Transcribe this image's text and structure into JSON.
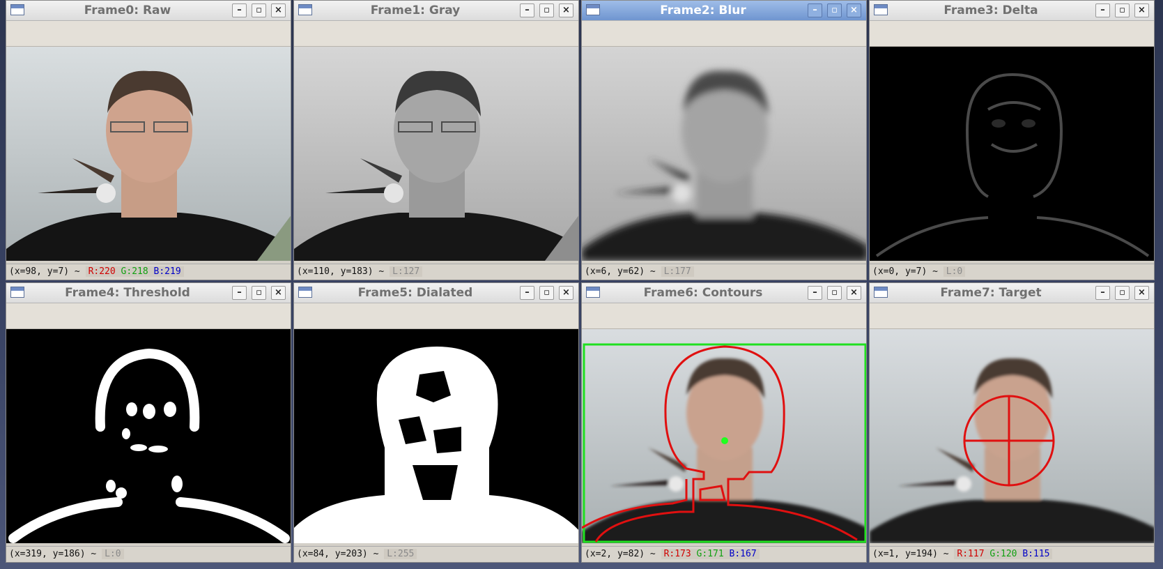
{
  "windows": [
    {
      "title": "Frame0: Raw",
      "status": {
        "coord": "(x=98, y=7) ~",
        "r": "R:220",
        "g": "G:218",
        "b": "B:219"
      }
    },
    {
      "title": "Frame1: Gray",
      "status": {
        "coord": "(x=110, y=183) ~",
        "l": "L:127"
      }
    },
    {
      "title": "Frame2: Blur",
      "status": {
        "coord": "(x=6, y=62) ~",
        "l": "L:177"
      }
    },
    {
      "title": "Frame3: Delta",
      "status": {
        "coord": "(x=0, y=7) ~",
        "l": "L:0"
      }
    },
    {
      "title": "Frame4: Threshold",
      "status": {
        "coord": "(x=319, y=186) ~",
        "l": "L:0"
      }
    },
    {
      "title": "Frame5: Dialated",
      "status": {
        "coord": "(x=84, y=203) ~",
        "l": "L:255"
      }
    },
    {
      "title": "Frame6: Contours",
      "status": {
        "coord": "(x=2, y=82) ~",
        "r": "R:173",
        "g": "G:171",
        "b": "B:167"
      }
    },
    {
      "title": "Frame7: Target",
      "status": {
        "coord": "(x=1, y=194) ~",
        "r": "R:117",
        "g": "G:120",
        "b": "B:115"
      }
    }
  ],
  "buttons": {
    "minimize": "–",
    "maximize": "▫",
    "close": "×"
  },
  "active_window": "Frame2: Blur",
  "icons": [
    "window-icon",
    "minimize-icon",
    "maximize-icon",
    "close-icon"
  ],
  "colors": {
    "contour": "#e01010",
    "bounding_box": "#20e020",
    "centroid": "#20ff20",
    "titlebar_active": "#7ea2d8"
  }
}
